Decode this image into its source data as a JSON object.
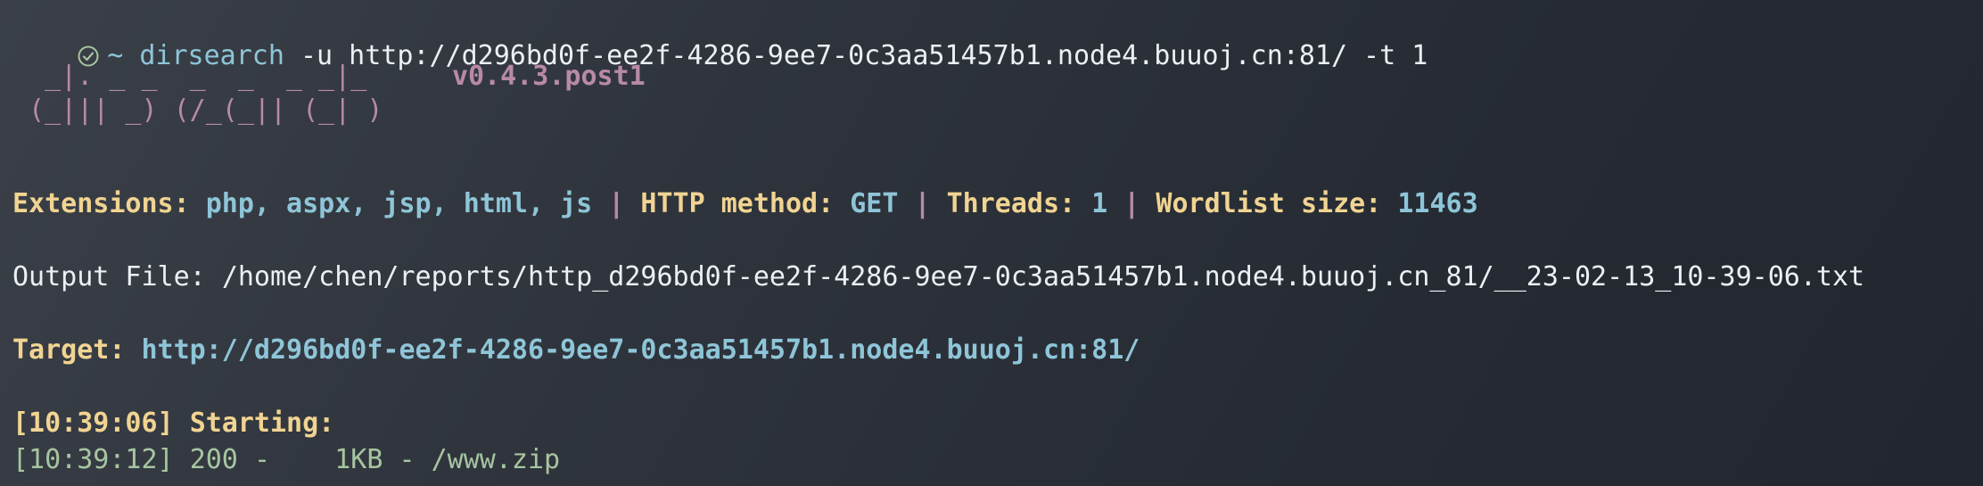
{
  "prompt": {
    "tilde": "~",
    "command": "dirsearch",
    "args": "-u http://d296bd0f-ee2f-4286-9ee7-0c3aa51457b1.node4.buuoj.cn:81/ -t 1"
  },
  "banner": {
    "line1": "  _|. _ _  _  _  _ _|_",
    "line2": " (_||| _) (/_(_|| (_| )",
    "version": "v0.4.3.post1"
  },
  "config": {
    "ext_label": "Extensions:",
    "ext_value": "php, aspx, jsp, html, js",
    "sep1": "|",
    "method_label": "HTTP method:",
    "method_value": "GET",
    "sep2": "|",
    "threads_label": "Threads:",
    "threads_value": "1",
    "sep3": "|",
    "wordlist_label": "Wordlist size:",
    "wordlist_value": "11463"
  },
  "output": {
    "label": "Output File:",
    "path": "/home/chen/reports/http_d296bd0f-ee2f-4286-9ee7-0c3aa51457b1.node4.buuoj.cn_81/__23-02-13_10-39-06.txt"
  },
  "target": {
    "label": "Target:",
    "url": "http://d296bd0f-ee2f-4286-9ee7-0c3aa51457b1.node4.buuoj.cn:81/"
  },
  "start": {
    "time": "[10:39:06]",
    "label": "Starting:"
  },
  "result": {
    "time": "[10:39:12]",
    "status": "200",
    "dash1": "-",
    "size": "1KB",
    "dash2": "-",
    "path": "/www.zip"
  },
  "colors": {
    "background": "#2c3139",
    "yellow": "#f1d492",
    "cyan": "#8ec5d8",
    "magenta": "#b88aa6",
    "green": "#a7c5a0"
  },
  "icons": {
    "prompt": "check-circle-icon"
  }
}
